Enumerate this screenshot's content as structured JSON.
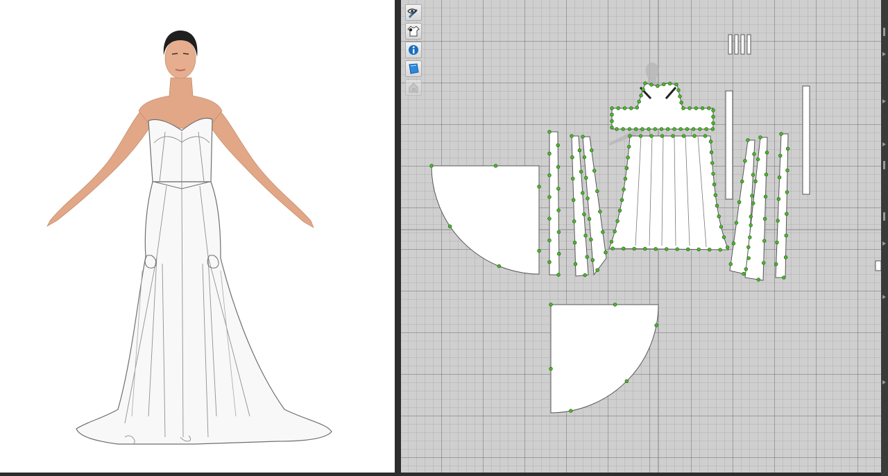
{
  "app": {
    "name": "",
    "views": [
      "3d-garment-window",
      "2d-pattern-window"
    ]
  },
  "viewport3d": {
    "background": "#ffffff",
    "avatar": {
      "skin": "#e2a787",
      "hair": "#1f1f1f",
      "lips": "#b7665c"
    },
    "garment": {
      "type": "strapless-gown",
      "fill": "#f8f8f8",
      "stroke": "#6e6e6e"
    }
  },
  "pattern2d": {
    "background": "#cfcfcf",
    "point_color": "#4cb82a",
    "point_stroke": "#1f5a12",
    "toolbar": [
      {
        "name": "show-pattern-tool",
        "icon": "pencil-eye-icon",
        "enabled": true
      },
      {
        "name": "show-garment-tool",
        "icon": "shirt-eye-icon",
        "enabled": true
      },
      {
        "name": "show-info-tool",
        "icon": "info-eye-icon",
        "enabled": true
      },
      {
        "name": "show-texture-tool",
        "icon": "fabric-swatch-icon",
        "enabled": true
      },
      {
        "name": "lock-avatar-tool",
        "icon": "avatar-lock-icon",
        "enabled": false
      }
    ]
  },
  "right_edge_icons": [
    "expand-arrow-icon",
    "expand-arrow-icon",
    "expand-arrow-icon",
    "expand-arrow-icon",
    "expand-arrow-icon",
    "expand-arrow-icon",
    "expand-arrow-icon"
  ]
}
